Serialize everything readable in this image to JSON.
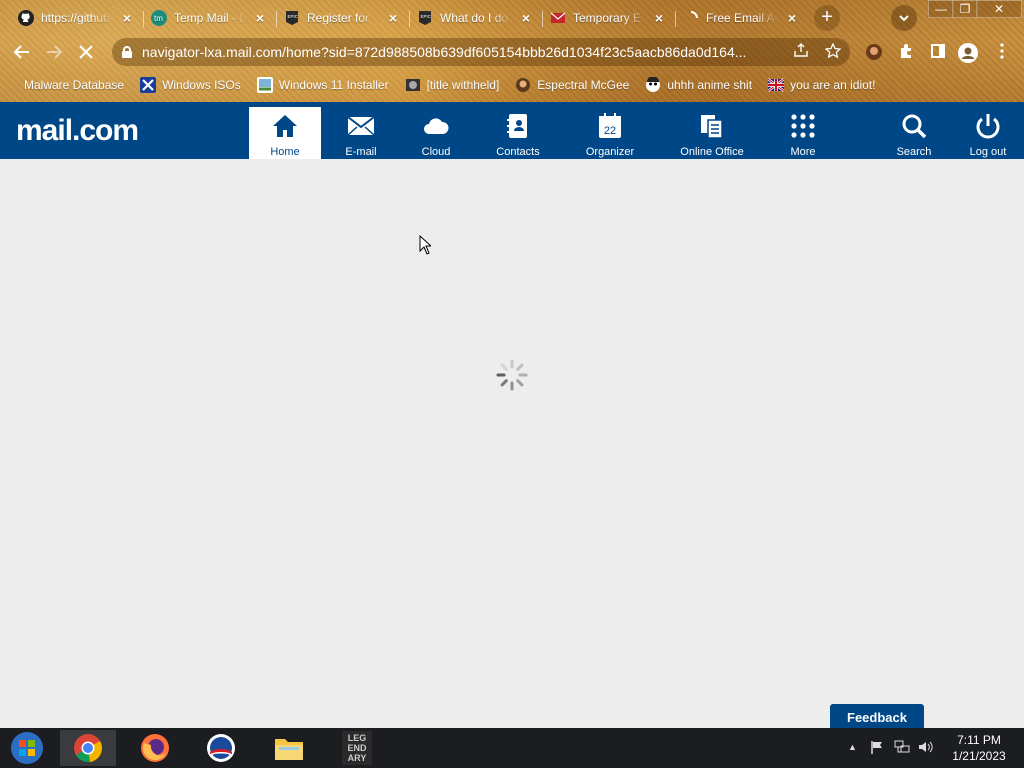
{
  "browser": {
    "tabs": [
      {
        "title": "https://github",
        "icon": "github-icon"
      },
      {
        "title": "Temp Mail - Di",
        "icon": "tempmail-icon"
      },
      {
        "title": "Register for",
        "icon": "epic-games-icon"
      },
      {
        "title": "What do I do",
        "icon": "epic-games-icon"
      },
      {
        "title": "Temporary E",
        "icon": "temporary-email-icon"
      },
      {
        "title": "Free Email Ac",
        "icon": "loading-icon"
      }
    ],
    "new_tab_label": "+",
    "tab_menu_label": "⌄",
    "window_controls": {
      "minimize": "—",
      "restore": "❐",
      "close": "✕"
    },
    "address_url": "navigator-lxa.mail.com/home?sid=872d988508b639df605154bbb26d1034f23c5aacb86da0d164...",
    "bookmarks": [
      {
        "label": "Malware Database",
        "icon": "blank-page-icon"
      },
      {
        "label": "Windows ISOs",
        "icon": "x-logo-icon"
      },
      {
        "label": "Windows 11 Installer",
        "icon": "image-icon"
      },
      {
        "label": "[title withheld]",
        "icon": "site-icon"
      },
      {
        "label": "Espectral McGee",
        "icon": "avatar-icon"
      },
      {
        "label": "uhhh anime shit",
        "icon": "anime-face-icon"
      },
      {
        "label": "you are an idiot!",
        "icon": "flag-icon"
      }
    ]
  },
  "mailcom": {
    "logo_text": "mail.com",
    "nav": [
      {
        "label": "Home",
        "icon": "home-icon",
        "active": true
      },
      {
        "label": "E-mail",
        "icon": "envelope-icon"
      },
      {
        "label": "Cloud",
        "icon": "cloud-icon"
      },
      {
        "label": "Contacts",
        "icon": "contacts-icon"
      },
      {
        "label": "Organizer",
        "icon": "calendar-icon",
        "badge": "22"
      },
      {
        "label": "Online Office",
        "icon": "documents-icon"
      },
      {
        "label": "More",
        "icon": "grid-icon"
      },
      {
        "label": "Search",
        "icon": "search-icon"
      },
      {
        "label": "Log out",
        "icon": "power-icon"
      }
    ],
    "feedback_label": "Feedback"
  },
  "taskbar": {
    "apps": [
      "start-orb",
      "chrome",
      "firefox",
      "obama-logo",
      "file-explorer",
      "legendary"
    ],
    "legendary_text": "LEG END ARY",
    "time": "7:11 PM",
    "date": "1/21/2023",
    "tray_arrow": "▲"
  },
  "colors": {
    "brand_blue": "#004788",
    "content_bg": "#ededed",
    "taskbar_bg": "#1c1d20"
  }
}
